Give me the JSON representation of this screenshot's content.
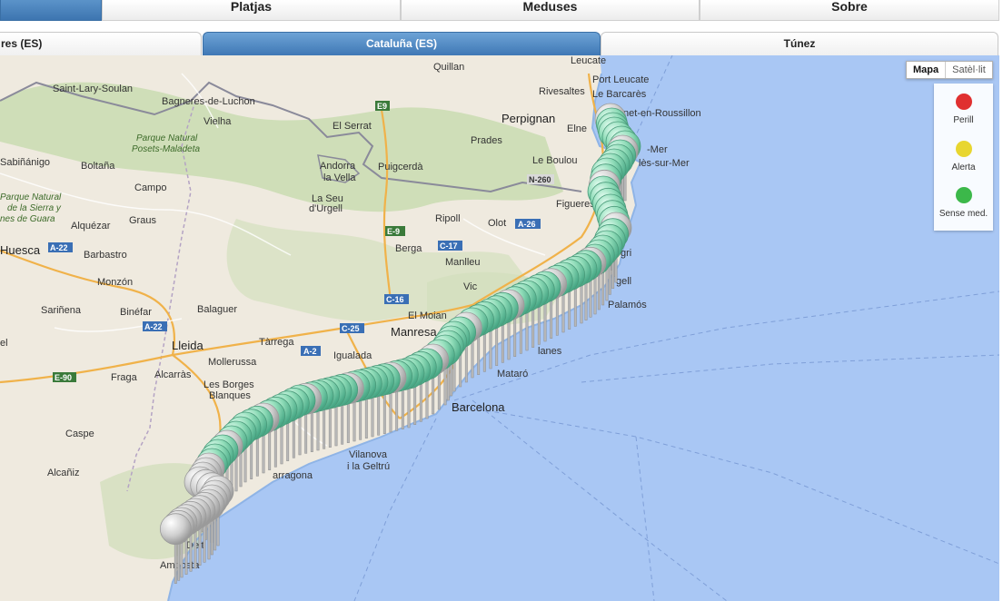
{
  "top_nav": {
    "tabs": [
      {
        "label": ""
      },
      {
        "label": "Platjas"
      },
      {
        "label": "Meduses"
      },
      {
        "label": "Sobre"
      }
    ]
  },
  "regions": {
    "tabs": [
      {
        "label": "res (ES)"
      },
      {
        "label": "Cataluña (ES)"
      },
      {
        "label": "Túnez"
      }
    ]
  },
  "map_type": {
    "map": "Mapa",
    "satellite": "Satèl·lit"
  },
  "legend": [
    {
      "label": "Perill",
      "color": "#e03030"
    },
    {
      "label": "Alerta",
      "color": "#e8d630"
    },
    {
      "label": "Sense med.",
      "color": "#3cb84a"
    }
  ],
  "map_labels": {
    "leucate": "Leucate",
    "quillan": "Quillan",
    "port_leucate": "Port Leucate",
    "rivesaltes": "Rivesaltes",
    "le_barcares": "Le Barcarès",
    "saint_lary": "Saint-Lary-Soulan",
    "bagneres": "Bagneres-de-Luchon",
    "vielha": "Vielha",
    "el_serrat": "El Serrat",
    "perpignan": "Perpignan",
    "canet": "Canet-en-Roussillon",
    "parque_posets": "Parque Natural Posets-Maladeta",
    "prades": "Prades",
    "elne": "Elne",
    "sabinanigo": "Sabiñánigo",
    "boltana": "Boltaña",
    "andorra": "Andorra la Vella",
    "puigcerda": "Puigcerdà",
    "le_boulou": "Le Boulou",
    "argeles": "lès-sur-Mer",
    "mer": "-Mer",
    "campo": "Campo",
    "la_seu": "La Seu d'Urgell",
    "figueres": "Figueres",
    "parque_guara": "Parque Natural de la Sierra y Cañones de Guara",
    "alquezar": "Alquézar",
    "graus": "Graus",
    "ripoll": "Ripoll",
    "olot": "Olot",
    "huesca": "Huesca",
    "berga": "Berga",
    "barbastro": "Barbastro",
    "manlleu": "Manlleu",
    "monzon": "Monzón",
    "vic": "Vic",
    "palamos": "Palamós",
    "sarinena": "Sariñena",
    "binefar": "Binéfar",
    "balaguer": "Balaguer",
    "manresa": "Manresa",
    "el_moian": "El Moian",
    "lleida": "Lleida",
    "tarrega": "Tàrrega",
    "igualada": "Igualada",
    "blanes": "lanes",
    "mollerussa": "Mollerussa",
    "fraga": "Fraga",
    "alcarras": "Alcarràs",
    "mataro": "Mataró",
    "les_borges": "Les Borges Blanques",
    "barcelona": "Barcelona",
    "caspe": "Caspe",
    "vilanova": "Vilanova i la Geltrú",
    "alcaniz": "Alcañiz",
    "tarragona": "arragona",
    "delta": "Delt",
    "amposta": "Amposta",
    "el": "el",
    "gri": "gri",
    "gell": "gell",
    "roads": {
      "e9_top": "E9",
      "n260": "N-260",
      "e9": "E-9",
      "a26": "A-26",
      "c17": "C-17",
      "a22": "A-22",
      "a22b": "A-22",
      "c16": "C-16",
      "c25": "C-25",
      "a2": "A-2",
      "e90": "E-90"
    }
  }
}
